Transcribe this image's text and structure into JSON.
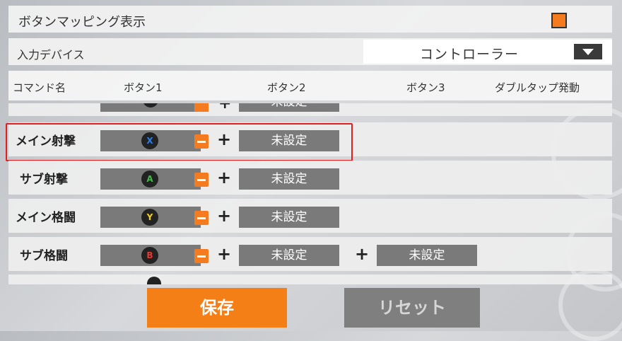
{
  "header": {
    "title": "ボタンマッピング表示"
  },
  "input_device": {
    "label": "入力デバイス",
    "value": "コントローラー"
  },
  "columns": {
    "command": "コマンド名",
    "button1": "ボタン1",
    "button2": "ボタン2",
    "button3": "ボタン3",
    "double_tap": "ダブルタップ発動"
  },
  "top_partial": {
    "unset": "未設定"
  },
  "rows": [
    {
      "name": "メイン射撃",
      "glyph": "X",
      "color": "#2f7fe8",
      "button2": "未設定"
    },
    {
      "name": "サブ射撃",
      "glyph": "A",
      "color": "#46b84a",
      "button2": "未設定"
    },
    {
      "name": "メイン格闘",
      "glyph": "Y",
      "color": "#f2cf1f",
      "button2": "未設定"
    },
    {
      "name": "サブ格闘",
      "glyph": "B",
      "color": "#e53935",
      "button2": "未設定",
      "button3": "未設定"
    }
  ],
  "footer": {
    "save_label": "保存",
    "reset_label": "リセット"
  }
}
